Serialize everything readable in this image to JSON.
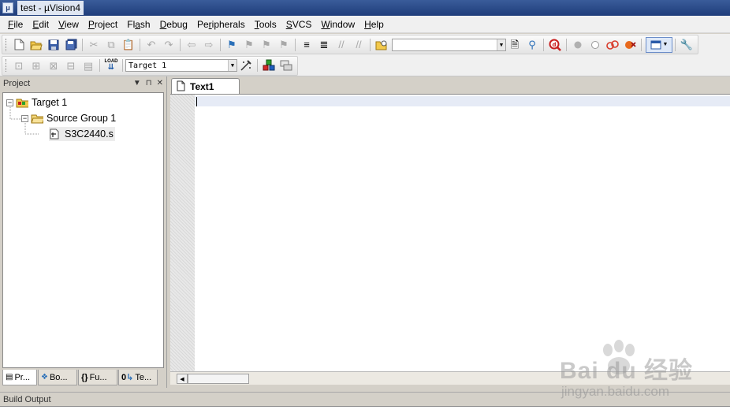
{
  "window": {
    "title": "test  - µVision4"
  },
  "menu": [
    {
      "pre": "",
      "u": "F",
      "post": "ile"
    },
    {
      "pre": "",
      "u": "E",
      "post": "dit"
    },
    {
      "pre": "",
      "u": "V",
      "post": "iew"
    },
    {
      "pre": "",
      "u": "P",
      "post": "roject"
    },
    {
      "pre": "Fl",
      "u": "a",
      "post": "sh"
    },
    {
      "pre": "",
      "u": "D",
      "post": "ebug"
    },
    {
      "pre": "Pe",
      "u": "r",
      "post": "ipherals"
    },
    {
      "pre": "",
      "u": "T",
      "post": "ools"
    },
    {
      "pre": "",
      "u": "S",
      "post": "VCS"
    },
    {
      "pre": "",
      "u": "W",
      "post": "indow"
    },
    {
      "pre": "",
      "u": "H",
      "post": "elp"
    }
  ],
  "toolbar2": {
    "target_combo": "Target 1",
    "load_label": "LOAD"
  },
  "project_panel": {
    "title": "Project",
    "tree": {
      "target": "Target 1",
      "group": "Source Group 1",
      "file": "S3C2440.s"
    },
    "tabs": [
      {
        "label": "Pr..."
      },
      {
        "label": "Bo..."
      },
      {
        "label": "Fu..."
      },
      {
        "label": "Te..."
      }
    ]
  },
  "editor": {
    "tab": "Text1"
  },
  "build_output": {
    "title": "Build Output"
  },
  "watermark": {
    "brand": "Bai du 经验",
    "url": "jingyan.baidu.com"
  }
}
